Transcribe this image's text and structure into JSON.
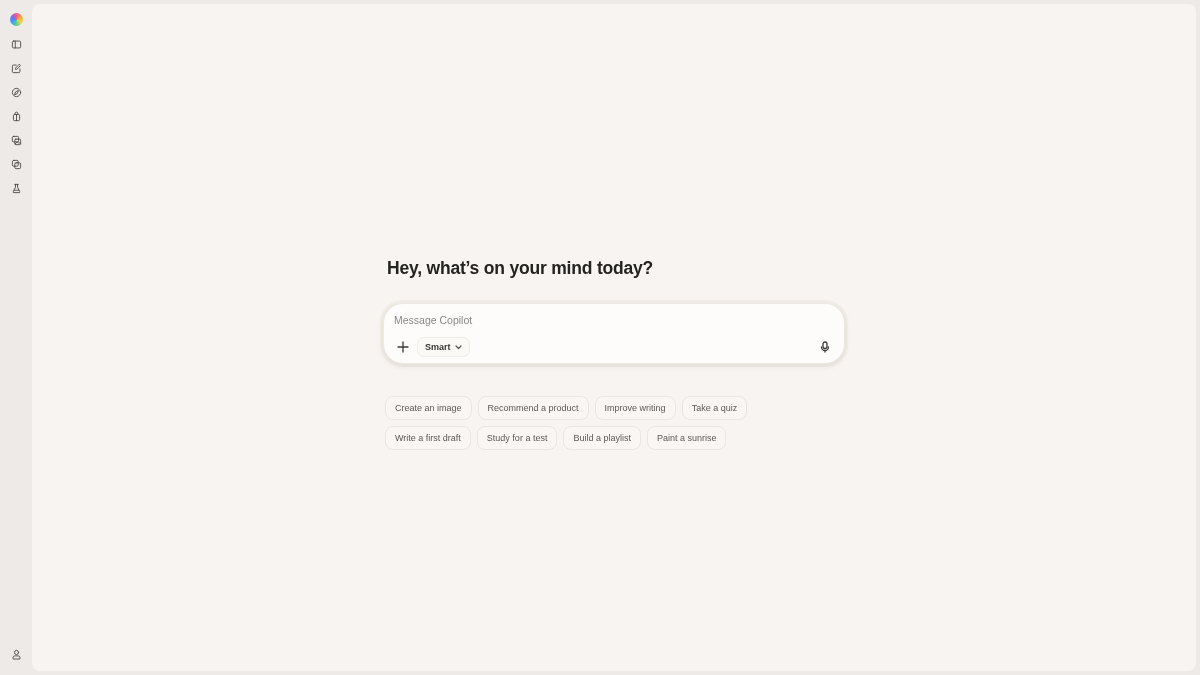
{
  "heading": "Hey, what’s on your mind today?",
  "composer": {
    "placeholder": "Message Copilot",
    "mode": "Smart"
  },
  "suggestions": [
    [
      "Create an image",
      "Recommend a product",
      "Improve writing",
      "Take a quiz"
    ],
    [
      "Write a first draft",
      "Study for a test",
      "Build a playlist",
      "Paint a sunrise"
    ]
  ]
}
